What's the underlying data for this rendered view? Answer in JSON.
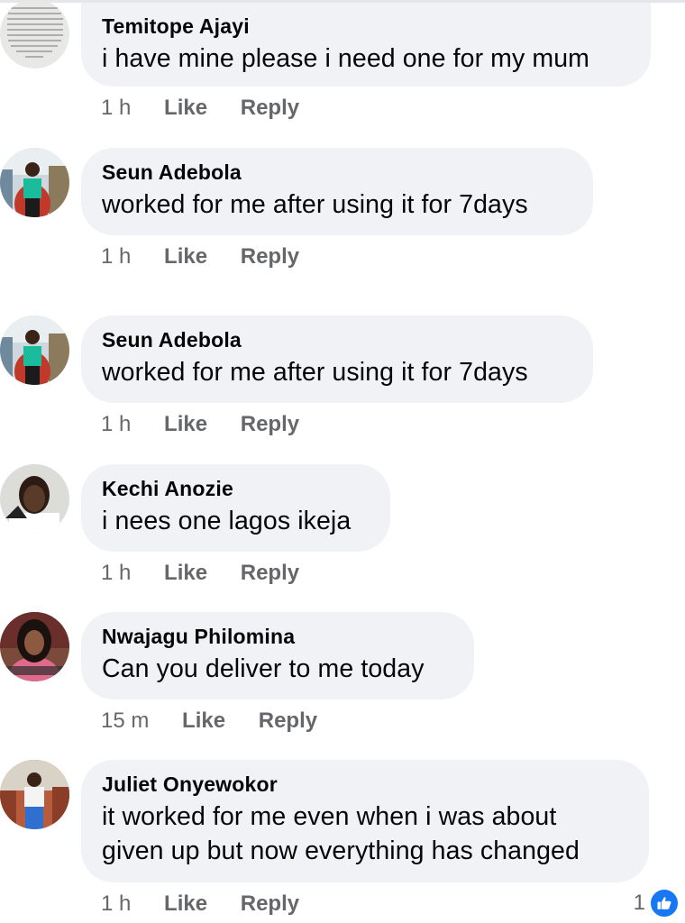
{
  "colors": {
    "bubble": "#f0f2f5",
    "text": "#050505",
    "meta": "#65676b",
    "like_blue": "#1877f2"
  },
  "comments": [
    {
      "author": "Temitope Ajayi",
      "text": "i have mine please i need one for my mum",
      "time": "1 h",
      "like": "Like",
      "reply": "Reply",
      "avatar_icon": "quote-image-avatar"
    },
    {
      "author": "Seun Adebola",
      "text": "worked for me after using it for 7days",
      "time": "1 h",
      "like": "Like",
      "reply": "Reply",
      "avatar_icon": "person-photo-avatar"
    },
    {
      "author": "Seun Adebola",
      "text": "worked for me after using it for 7days",
      "time": "1 h",
      "like": "Like",
      "reply": "Reply",
      "avatar_icon": "person-photo-avatar"
    },
    {
      "author": "Kechi Anozie",
      "text": "i nees one lagos ikeja",
      "time": "1 h",
      "like": "Like",
      "reply": "Reply",
      "avatar_icon": "person-photo-avatar"
    },
    {
      "author": "Nwajagu Philomina",
      "text": "Can you deliver to me today",
      "time": "15 m",
      "like": "Like",
      "reply": "Reply",
      "avatar_icon": "person-photo-avatar"
    },
    {
      "author": "Juliet Onyewokor",
      "text_line1": "it worked for me even when i was about",
      "text_line2": "given up but now everything has changed",
      "time": "1 h",
      "like": "Like",
      "reply": "Reply",
      "avatar_icon": "person-photo-avatar",
      "reaction_count": "1",
      "reaction_icon": "thumbs-up-icon"
    }
  ]
}
